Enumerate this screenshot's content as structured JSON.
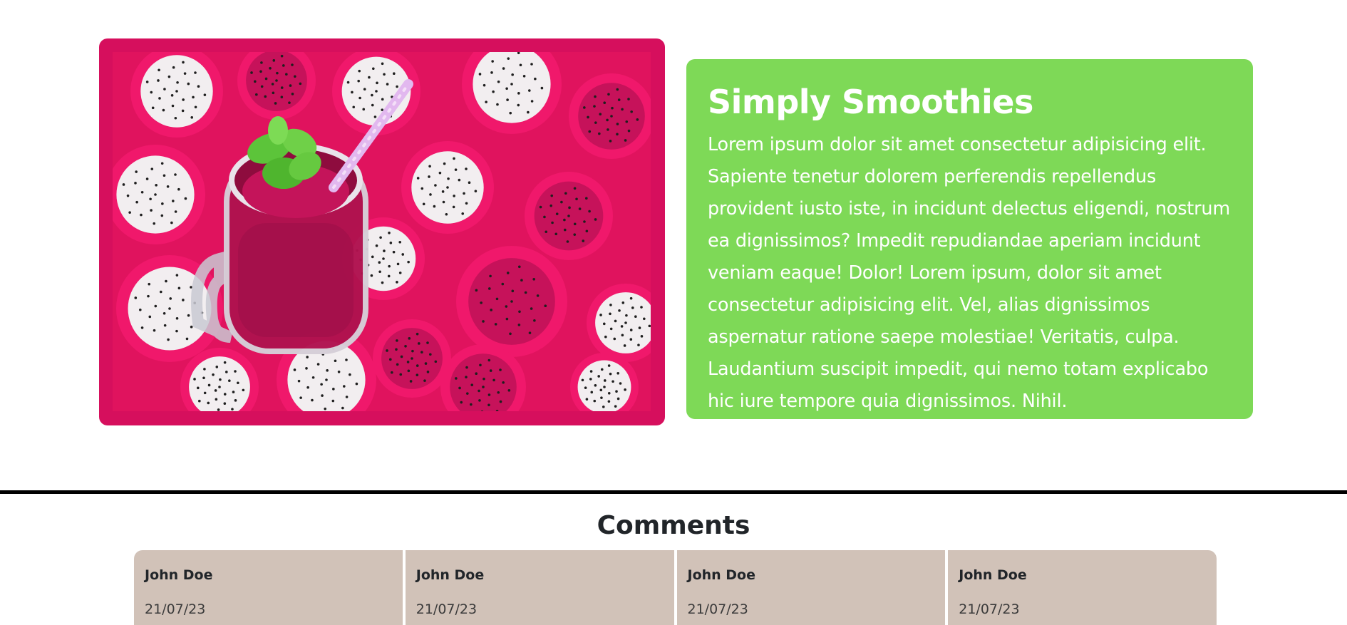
{
  "hero": {
    "image_alt": "Dragon fruit smoothie jar with straw and mint on sliced dragon fruit",
    "frame_color": "#d60f5d",
    "card_color": "#7ed957",
    "title": "Simply Smoothies",
    "body": "Lorem ipsum dolor sit amet consectetur adipisicing elit. Sapiente tenetur dolorem perferendis repellendus provident iusto iste, in incidunt delectus eligendi, nostrum ea dignissimos? Impedit repudiandae aperiam incidunt veniam eaque! Dolor! Lorem ipsum, dolor sit amet consectetur adipisicing elit. Vel, alias dignissimos aspernatur ratione saepe molestiae! Veritatis, culpa. Laudantium suscipit impedit, qui nemo totam explicabo hic iure tempore quia dignissimos. Nihil."
  },
  "comments": {
    "heading": "Comments",
    "card_color": "#d1c2b8",
    "items": [
      {
        "author": "John Doe",
        "date": "21/07/23"
      },
      {
        "author": "John Doe",
        "date": "21/07/23"
      },
      {
        "author": "John Doe",
        "date": "21/07/23"
      },
      {
        "author": "John Doe",
        "date": "21/07/23"
      }
    ]
  }
}
